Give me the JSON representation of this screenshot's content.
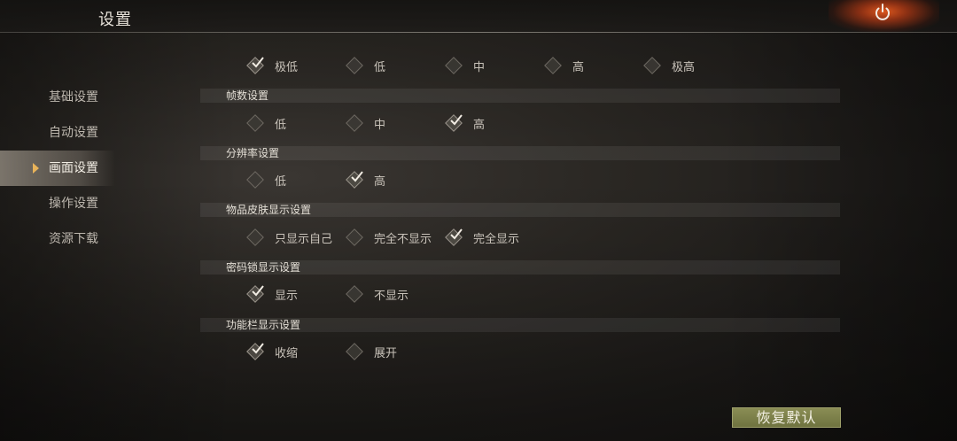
{
  "header": {
    "title": "设置"
  },
  "sidebar": {
    "items": [
      {
        "label": "基础设置",
        "active": false
      },
      {
        "label": "自动设置",
        "active": false
      },
      {
        "label": "画面设置",
        "active": true
      },
      {
        "label": "操作设置",
        "active": false
      },
      {
        "label": "资源下载",
        "active": false
      }
    ]
  },
  "quality": {
    "options": [
      {
        "label": "极低",
        "checked": true
      },
      {
        "label": "低",
        "checked": false
      },
      {
        "label": "中",
        "checked": false
      },
      {
        "label": "高",
        "checked": false
      },
      {
        "label": "极高",
        "checked": false
      }
    ]
  },
  "framerate": {
    "title": "帧数设置",
    "options": [
      {
        "label": "低",
        "checked": false
      },
      {
        "label": "中",
        "checked": false
      },
      {
        "label": "高",
        "checked": true
      }
    ]
  },
  "resolution": {
    "title": "分辨率设置",
    "options": [
      {
        "label": "低",
        "checked": false
      },
      {
        "label": "高",
        "checked": true
      }
    ]
  },
  "skin": {
    "title": "物品皮肤显示设置",
    "options": [
      {
        "label": "只显示自己",
        "checked": false
      },
      {
        "label": "完全不显示",
        "checked": false
      },
      {
        "label": "完全显示",
        "checked": true
      }
    ]
  },
  "lock": {
    "title": "密码锁显示设置",
    "options": [
      {
        "label": "显示",
        "checked": true
      },
      {
        "label": "不显示",
        "checked": false
      }
    ]
  },
  "toolbar": {
    "title": "功能栏显示设置",
    "options": [
      {
        "label": "收缩",
        "checked": true
      },
      {
        "label": "展开",
        "checked": false
      }
    ]
  },
  "restore_label": "恢复默认",
  "colors": {
    "accent_arrow": "#e8b35a",
    "restore_button": "#7d8049",
    "power_glow": "#e65a1e"
  }
}
